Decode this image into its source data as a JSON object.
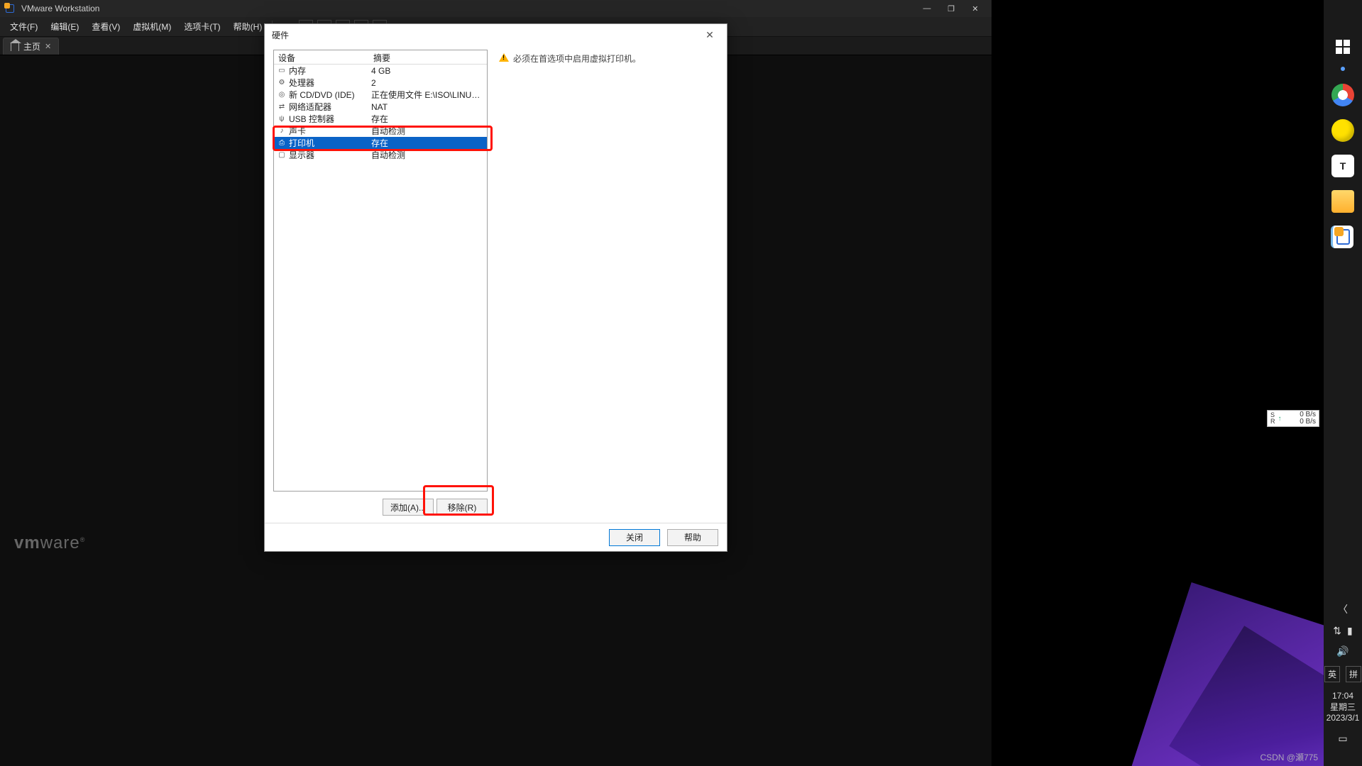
{
  "app": {
    "title": "VMware Workstation",
    "menus": [
      "文件(F)",
      "编辑(E)",
      "查看(V)",
      "虚拟机(M)",
      "选项卡(T)",
      "帮助(H)"
    ],
    "tab_home": "主页",
    "logo_html": "vmware"
  },
  "window_controls": {
    "min": "—",
    "max": "❐",
    "close": "✕"
  },
  "dialog": {
    "title": "硬件",
    "headers": {
      "device": "设备",
      "summary": "摘要"
    },
    "rows": [
      {
        "icon": "mem",
        "device": "内存",
        "summary": "4 GB",
        "selected": false
      },
      {
        "icon": "cpu",
        "device": "处理器",
        "summary": "2",
        "selected": false
      },
      {
        "icon": "cd",
        "device": "新 CD/DVD (IDE)",
        "summary": "正在使用文件 E:\\ISO\\LINUX...",
        "selected": false
      },
      {
        "icon": "net",
        "device": "网络适配器",
        "summary": "NAT",
        "selected": false
      },
      {
        "icon": "usb",
        "device": "USB 控制器",
        "summary": "存在",
        "selected": false
      },
      {
        "icon": "snd",
        "device": "声卡",
        "summary": "自动检测",
        "selected": false
      },
      {
        "icon": "prn",
        "device": "打印机",
        "summary": "存在",
        "selected": true
      },
      {
        "icon": "disp",
        "device": "显示器",
        "summary": "自动检测",
        "selected": false
      }
    ],
    "add_btn": "添加(A)...",
    "remove_btn": "移除(R)",
    "notice": "必须在首选项中启用虚拟打印机。",
    "close_btn": "关闭",
    "help_btn": "帮助"
  },
  "netspeed": {
    "s_lbl": "S",
    "r_lbl": "R",
    "up": "0 B/s",
    "down": "0 B/s"
  },
  "tray": {
    "chevron": "〈",
    "ime_lang": "英",
    "ime_mode": "拼",
    "time": "17:04",
    "weekday": "星期三",
    "date": "2023/3/1"
  },
  "watermark": "CSDN @瀬775"
}
